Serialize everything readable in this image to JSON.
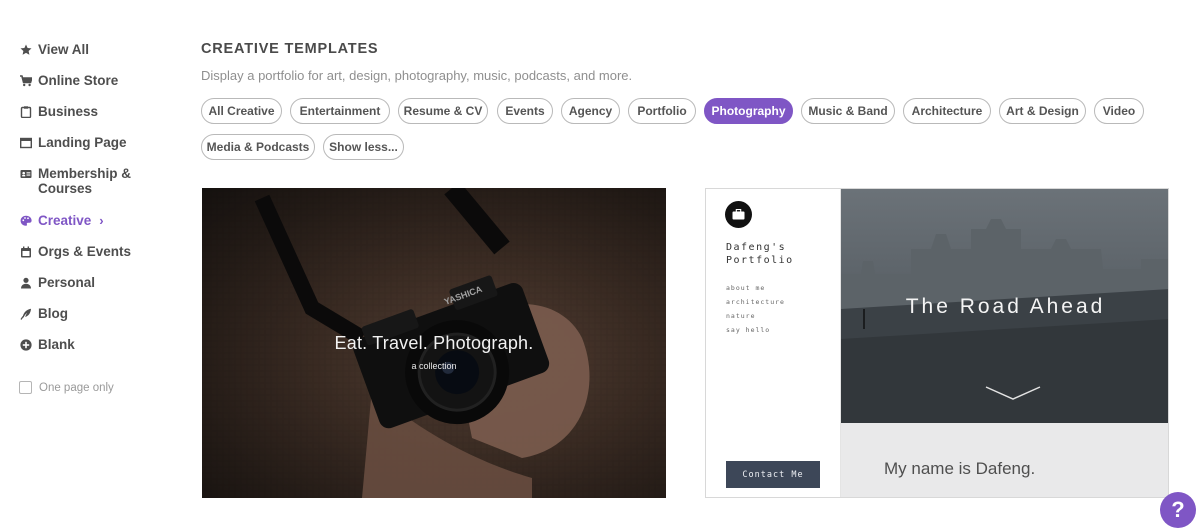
{
  "sidebar": {
    "items": [
      {
        "label": "View All",
        "icon": "star-icon"
      },
      {
        "label": "Online Store",
        "icon": "cart-icon"
      },
      {
        "label": "Business",
        "icon": "clipboard-icon"
      },
      {
        "label": "Landing Page",
        "icon": "browser-window-icon"
      },
      {
        "label": "Membership &\nCourses",
        "icon": "id-card-icon"
      },
      {
        "label": "Creative",
        "icon": "palette-icon",
        "active": true
      },
      {
        "label": "Orgs & Events",
        "icon": "calendar-icon"
      },
      {
        "label": "Personal",
        "icon": "person-icon"
      },
      {
        "label": "Blog",
        "icon": "quill-icon"
      },
      {
        "label": "Blank",
        "icon": "plus-circle-icon"
      }
    ],
    "creative_chevron": "›",
    "one_page_only": "One page only"
  },
  "main": {
    "heading": "CREATIVE TEMPLATES",
    "subheading": "Display a portfolio for art, design, photography, music, podcasts, and more.",
    "chips": [
      "All Creative",
      "Entertainment",
      "Resume & CV",
      "Events",
      "Agency",
      "Portfolio",
      "Photography",
      "Music & Band",
      "Architecture",
      "Art & Design",
      "Video",
      "Media & Podcasts",
      "Show less..."
    ],
    "selected_chip": "Photography"
  },
  "templates": {
    "card1": {
      "tagline": "Eat. Travel. Photograph.",
      "subtag": "a collection",
      "camera_brand": "YASHICA"
    },
    "card2": {
      "site_name": "Dafeng's Portfolio",
      "menu": [
        "about me",
        "architecture",
        "nature",
        "say hello"
      ],
      "hero_title": "The Road Ahead",
      "contact_button": "Contact Me",
      "intro": "My name is Dafeng."
    }
  },
  "help": {
    "label": "?"
  },
  "colors": {
    "accent": "#7f56c5",
    "text": "#4e4e4e",
    "muted": "#8f8f8f",
    "contact_button_bg": "#3d4758"
  }
}
